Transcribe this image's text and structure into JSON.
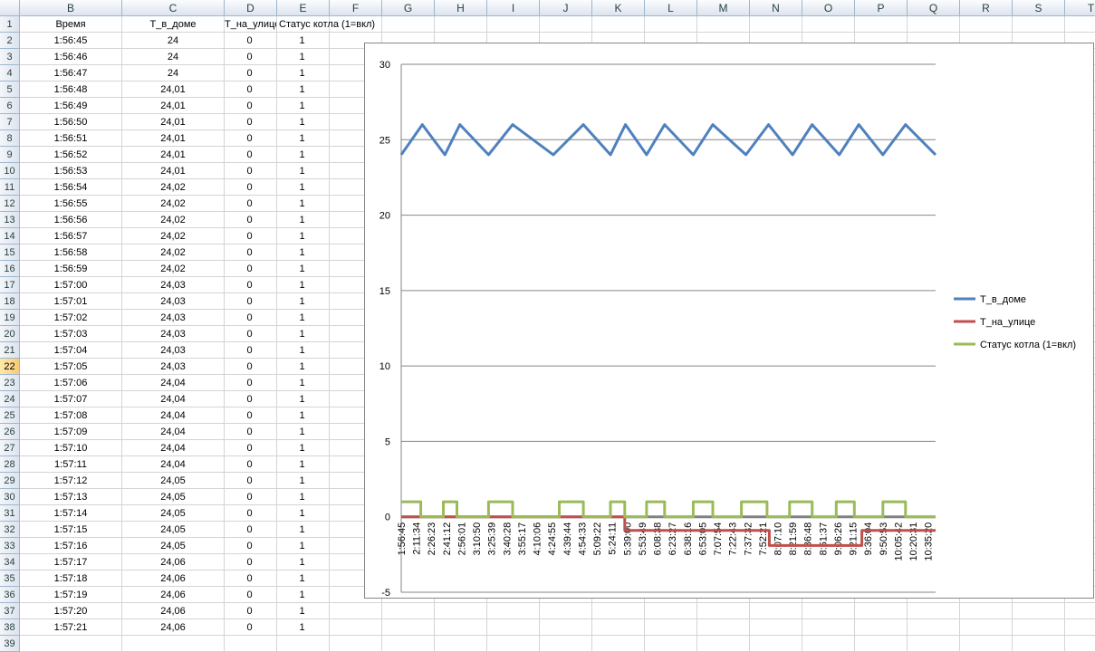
{
  "columns": [
    "B",
    "C",
    "D",
    "E",
    "F",
    "G",
    "H",
    "I",
    "J",
    "K",
    "L",
    "M",
    "N",
    "O",
    "P",
    "Q",
    "R",
    "S",
    "T"
  ],
  "selected_row": "22",
  "headers": {
    "time": "Время",
    "t_home": "Т_в_доме",
    "t_out": "Т_на_улице",
    "status": "Статус котла (1=вкл)"
  },
  "rows": [
    [
      "1:56:45",
      "24",
      "0",
      "1"
    ],
    [
      "1:56:46",
      "24",
      "0",
      "1"
    ],
    [
      "1:56:47",
      "24",
      "0",
      "1"
    ],
    [
      "1:56:48",
      "24,01",
      "0",
      "1"
    ],
    [
      "1:56:49",
      "24,01",
      "0",
      "1"
    ],
    [
      "1:56:50",
      "24,01",
      "0",
      "1"
    ],
    [
      "1:56:51",
      "24,01",
      "0",
      "1"
    ],
    [
      "1:56:52",
      "24,01",
      "0",
      "1"
    ],
    [
      "1:56:53",
      "24,01",
      "0",
      "1"
    ],
    [
      "1:56:54",
      "24,02",
      "0",
      "1"
    ],
    [
      "1:56:55",
      "24,02",
      "0",
      "1"
    ],
    [
      "1:56:56",
      "24,02",
      "0",
      "1"
    ],
    [
      "1:56:57",
      "24,02",
      "0",
      "1"
    ],
    [
      "1:56:58",
      "24,02",
      "0",
      "1"
    ],
    [
      "1:56:59",
      "24,02",
      "0",
      "1"
    ],
    [
      "1:57:00",
      "24,03",
      "0",
      "1"
    ],
    [
      "1:57:01",
      "24,03",
      "0",
      "1"
    ],
    [
      "1:57:02",
      "24,03",
      "0",
      "1"
    ],
    [
      "1:57:03",
      "24,03",
      "0",
      "1"
    ],
    [
      "1:57:04",
      "24,03",
      "0",
      "1"
    ],
    [
      "1:57:05",
      "24,03",
      "0",
      "1"
    ],
    [
      "1:57:06",
      "24,04",
      "0",
      "1"
    ],
    [
      "1:57:07",
      "24,04",
      "0",
      "1"
    ],
    [
      "1:57:08",
      "24,04",
      "0",
      "1"
    ],
    [
      "1:57:09",
      "24,04",
      "0",
      "1"
    ],
    [
      "1:57:10",
      "24,04",
      "0",
      "1"
    ],
    [
      "1:57:11",
      "24,04",
      "0",
      "1"
    ],
    [
      "1:57:12",
      "24,05",
      "0",
      "1"
    ],
    [
      "1:57:13",
      "24,05",
      "0",
      "1"
    ],
    [
      "1:57:14",
      "24,05",
      "0",
      "1"
    ],
    [
      "1:57:15",
      "24,05",
      "0",
      "1"
    ],
    [
      "1:57:16",
      "24,05",
      "0",
      "1"
    ],
    [
      "1:57:17",
      "24,06",
      "0",
      "1"
    ],
    [
      "1:57:18",
      "24,06",
      "0",
      "1"
    ],
    [
      "1:57:19",
      "24,06",
      "0",
      "1"
    ],
    [
      "1:57:20",
      "24,06",
      "0",
      "1"
    ],
    [
      "1:57:21",
      "24,06",
      "0",
      "1"
    ]
  ],
  "chart_data": {
    "type": "line",
    "ylim": [
      -5,
      30
    ],
    "yticks": [
      -5,
      0,
      5,
      10,
      15,
      20,
      25,
      30
    ],
    "x_tick_labels": [
      "1:56:45",
      "2:11:34",
      "2:26:23",
      "2:41:12",
      "2:56:01",
      "3:10:50",
      "3:25:39",
      "3:40:28",
      "3:55:17",
      "4:10:06",
      "4:24:55",
      "4:39:44",
      "4:54:33",
      "5:09:22",
      "5:24:11",
      "5:39:00",
      "5:53:49",
      "6:08:38",
      "6:23:27",
      "6:38:16",
      "6:53:05",
      "7:07:54",
      "7:22:43",
      "7:37:32",
      "7:52:21",
      "8:07:10",
      "8:21:59",
      "8:36:48",
      "8:51:37",
      "9:06:26",
      "9:21:15",
      "9:36:04",
      "9:50:53",
      "10:05:42",
      "10:20:31",
      "10:35:20"
    ],
    "legend_position": "right",
    "grid": true,
    "series": [
      {
        "name": "Т_в_доме",
        "color": "#4f81bd",
        "points": [
          [
            0,
            24
          ],
          [
            1.4,
            26
          ],
          [
            2.9,
            24
          ],
          [
            3.9,
            26
          ],
          [
            5.8,
            24
          ],
          [
            7.4,
            26
          ],
          [
            10.1,
            24
          ],
          [
            12.1,
            26
          ],
          [
            13.9,
            24
          ],
          [
            14.9,
            26
          ],
          [
            16.3,
            24
          ],
          [
            17.5,
            26
          ],
          [
            19.4,
            24
          ],
          [
            20.7,
            26
          ],
          [
            22.9,
            24
          ],
          [
            24.4,
            26
          ],
          [
            26.0,
            24
          ],
          [
            27.3,
            26
          ],
          [
            29.1,
            24
          ],
          [
            30.4,
            26
          ],
          [
            32.0,
            24
          ],
          [
            33.5,
            26
          ],
          [
            35.5,
            24
          ]
        ]
      },
      {
        "name": "Т_на_улице",
        "color": "#c0504d",
        "points": [
          [
            0,
            0
          ],
          [
            14.85,
            0
          ],
          [
            14.85,
            -0.9
          ],
          [
            24.45,
            -0.9
          ],
          [
            24.45,
            -1.9
          ],
          [
            30.6,
            -1.9
          ],
          [
            30.6,
            -0.9
          ],
          [
            35.5,
            -0.9
          ]
        ]
      },
      {
        "name": "Статус котла (1=вкл)",
        "color": "#9bbb59",
        "points": [
          [
            0,
            1
          ],
          [
            1.3,
            1
          ],
          [
            1.3,
            0
          ],
          [
            2.8,
            0
          ],
          [
            2.8,
            1
          ],
          [
            3.7,
            1
          ],
          [
            3.7,
            0
          ],
          [
            5.8,
            0
          ],
          [
            5.8,
            1
          ],
          [
            7.4,
            1
          ],
          [
            7.4,
            0
          ],
          [
            10.5,
            0
          ],
          [
            10.5,
            1
          ],
          [
            12.1,
            1
          ],
          [
            12.1,
            0
          ],
          [
            13.9,
            0
          ],
          [
            13.9,
            1
          ],
          [
            14.85,
            1
          ],
          [
            14.85,
            0
          ],
          [
            16.3,
            0
          ],
          [
            16.3,
            1
          ],
          [
            17.5,
            1
          ],
          [
            17.5,
            0
          ],
          [
            19.4,
            0
          ],
          [
            19.4,
            1
          ],
          [
            20.7,
            1
          ],
          [
            20.7,
            0
          ],
          [
            22.6,
            0
          ],
          [
            22.6,
            1
          ],
          [
            24.3,
            1
          ],
          [
            24.3,
            0
          ],
          [
            25.8,
            0
          ],
          [
            25.8,
            1
          ],
          [
            27.3,
            1
          ],
          [
            27.3,
            0
          ],
          [
            28.9,
            0
          ],
          [
            28.9,
            1
          ],
          [
            30.1,
            1
          ],
          [
            30.1,
            0
          ],
          [
            32.0,
            0
          ],
          [
            32.0,
            1
          ],
          [
            33.5,
            1
          ],
          [
            33.5,
            0
          ],
          [
            35.5,
            0
          ]
        ]
      }
    ],
    "baseline_color": "#808080"
  }
}
